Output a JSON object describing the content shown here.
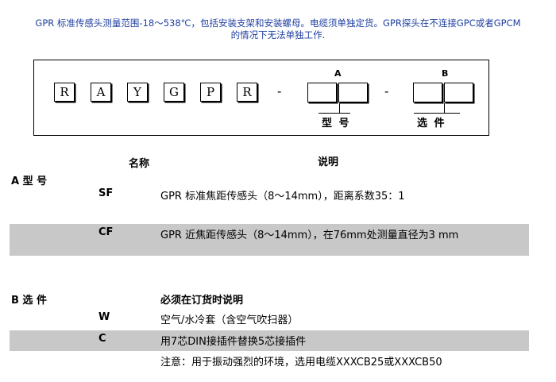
{
  "intro": {
    "line1": "GPR 标准传感头测量范围-18～538℃，包括安装支架和安装螺母。电缆须单独定货。GPR探头在不连接GPC或者GPCM",
    "line2": "的情况下无法单独工作."
  },
  "diagram": {
    "letters": [
      "R",
      "A",
      "Y",
      "G",
      "P",
      "R"
    ],
    "dash": "-",
    "slot_a_letter": "A",
    "slot_a_caption": "型 号",
    "slot_b_letter": "B",
    "slot_b_caption": "选 件"
  },
  "table": {
    "col_name": "名称",
    "col_desc": "说明",
    "section_a": "A  型 号",
    "rows_a": [
      {
        "code": "SF",
        "desc": "GPR 标准焦距传感头（8～14mm），距离系数35：1"
      },
      {
        "code": "CF",
        "desc": "GPR 近焦距传感头（8～14mm），在76mm处测量直径为3 mm"
      }
    ],
    "section_b": "B 选 件",
    "section_b_note": "必须在订货时说明",
    "rows_b": [
      {
        "code": "W",
        "desc": "空气/水冷套（含空气吹扫器）"
      },
      {
        "code": "C",
        "desc": "用7芯DIN接插件替换5芯接插件"
      }
    ],
    "footnote": "注意：用于振动强烈的环境，选用电缆XXXCB25或XXXCB50"
  },
  "colors": {
    "intro_text": "#1f3fa0",
    "band": "#c8c8c8"
  }
}
